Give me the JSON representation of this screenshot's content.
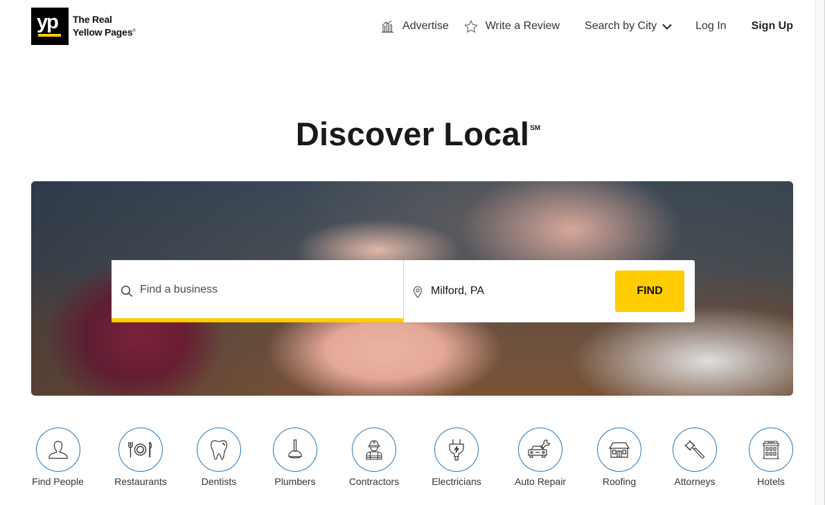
{
  "brand": {
    "logo_mark": "yp",
    "name_line1": "The Real",
    "name_line2": "Yellow Pages",
    "trademark": "®",
    "accent_color": "#ffcd00"
  },
  "nav": {
    "advertise": {
      "label": "Advertise",
      "icon": "bar-chart-icon"
    },
    "write_review": {
      "label": "Write a Review",
      "icon": "star-outline-icon"
    },
    "search_by_city": {
      "label": "Search by City",
      "icon": "chevron-down-icon"
    },
    "log_in": {
      "label": "Log In"
    },
    "sign_up": {
      "label": "Sign Up"
    }
  },
  "hero": {
    "title": "Discover Local",
    "title_mark": "SM"
  },
  "search": {
    "what_placeholder": "Find a business",
    "what_value": "",
    "what_icon": "search-icon",
    "where_value": "Milford, PA",
    "where_icon": "location-pin-icon",
    "find_label": "FIND"
  },
  "categories": [
    {
      "label": "Find People",
      "icon": "person-icon"
    },
    {
      "label": "Restaurants",
      "icon": "plate-utensils-icon"
    },
    {
      "label": "Dentists",
      "icon": "tooth-icon"
    },
    {
      "label": "Plumbers",
      "icon": "plunger-icon"
    },
    {
      "label": "Contractors",
      "icon": "worker-hardhat-icon"
    },
    {
      "label": "Electricians",
      "icon": "electric-plug-icon"
    },
    {
      "label": "Auto Repair",
      "icon": "car-wrench-icon"
    },
    {
      "label": "Roofing",
      "icon": "house-roof-icon"
    },
    {
      "label": "Attorneys",
      "icon": "gavel-icon"
    },
    {
      "label": "Hotels",
      "icon": "hotel-building-icon"
    }
  ],
  "colors": {
    "category_ring": "#2878b5",
    "find_button": "#ffcd00",
    "search_underline": "#ffcd00"
  }
}
